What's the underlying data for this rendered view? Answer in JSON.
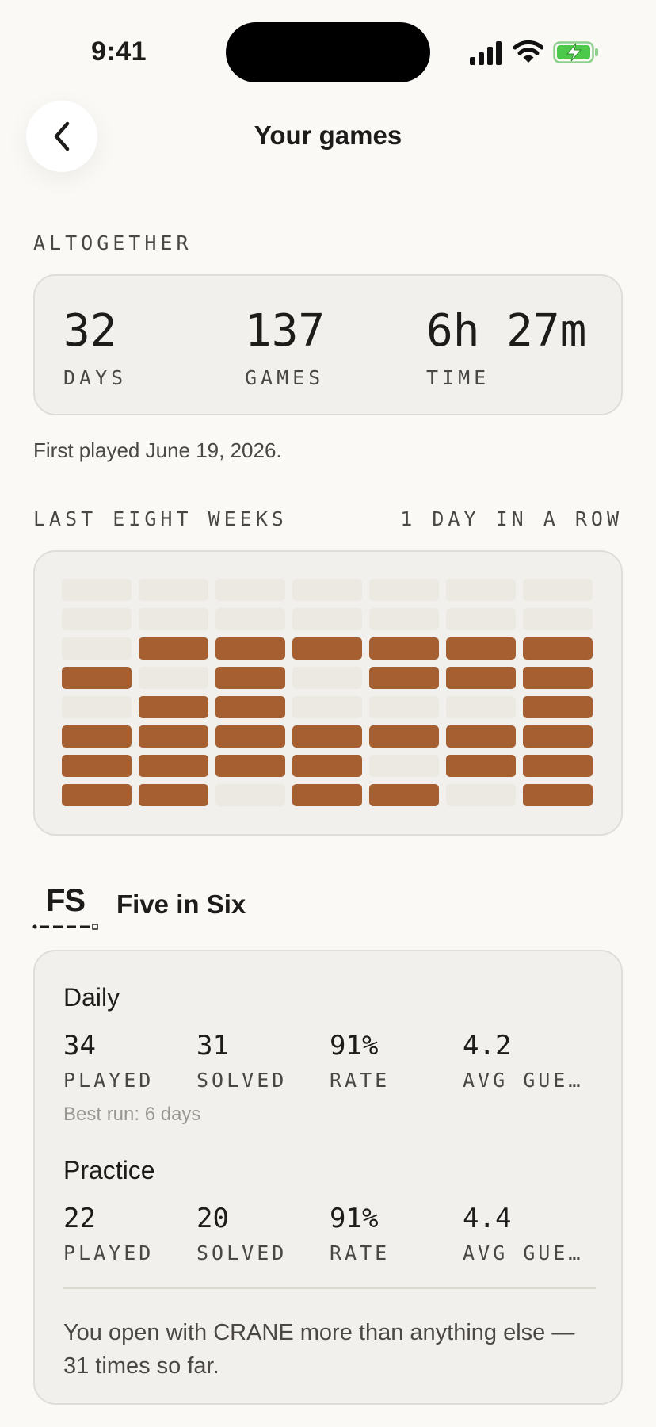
{
  "status_bar": {
    "time": "9:41"
  },
  "header": {
    "title": "Your games"
  },
  "altogether": {
    "label": "ALTOGETHER",
    "stats": [
      {
        "value": "32",
        "label": "DAYS"
      },
      {
        "value": "137",
        "label": "GAMES"
      },
      {
        "value": "6h 27m",
        "label": "TIME"
      }
    ],
    "first_played": "First played June 19, 2026."
  },
  "weeks": {
    "label": "LAST EIGHT WEEKS",
    "streak": "1 DAY IN A ROW",
    "rows": [
      [
        0,
        0,
        0,
        0,
        0,
        0,
        0
      ],
      [
        0,
        0,
        0,
        0,
        0,
        0,
        0
      ],
      [
        0,
        1,
        1,
        1,
        1,
        1,
        1
      ],
      [
        1,
        0,
        1,
        0,
        1,
        1,
        1
      ],
      [
        0,
        1,
        1,
        0,
        0,
        0,
        1
      ],
      [
        1,
        1,
        1,
        1,
        1,
        1,
        1
      ],
      [
        1,
        1,
        1,
        1,
        0,
        1,
        1
      ],
      [
        1,
        1,
        0,
        1,
        1,
        0,
        1
      ]
    ],
    "active_color": "#a55f31",
    "inactive_color": "#ece9e2"
  },
  "game": {
    "logo": "FS",
    "name": "Five in Six",
    "daily": {
      "title": "Daily",
      "stats": [
        {
          "value": "34",
          "label": "PLAYED"
        },
        {
          "value": "31",
          "label": "SOLVED"
        },
        {
          "value": "91%",
          "label": "RATE"
        },
        {
          "value": "4.2",
          "label": "AVG GUESSES"
        }
      ],
      "best_run": "Best run: 6 days"
    },
    "practice": {
      "title": "Practice",
      "stats": [
        {
          "value": "22",
          "label": "PLAYED"
        },
        {
          "value": "20",
          "label": "SOLVED"
        },
        {
          "value": "91%",
          "label": "RATE"
        },
        {
          "value": "4.4",
          "label": "AVG GUESSES"
        }
      ]
    },
    "insight": "You open with CRANE more than anything else — 31 times so far."
  }
}
